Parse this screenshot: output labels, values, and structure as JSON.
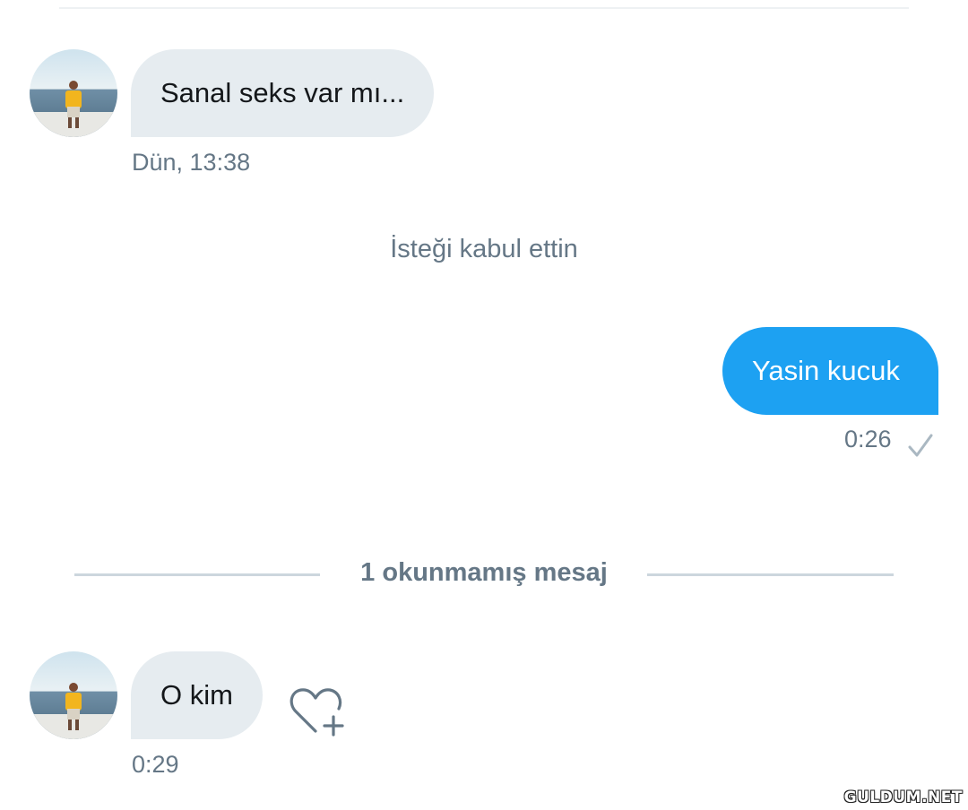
{
  "conversation": {
    "messages": [
      {
        "direction": "incoming",
        "text": "Sanal seks var mı...",
        "time": "Dün, 13:38"
      },
      {
        "direction": "outgoing",
        "text": "Yasin kucuk",
        "time": "0:26",
        "status_icon": "check-icon"
      },
      {
        "direction": "incoming",
        "text": "O kim",
        "time": "0:29",
        "reaction_icon": "heart-add-icon"
      }
    ],
    "system_note": "İsteği kabul ettin",
    "unread_divider": "1 okunmamış mesaj"
  },
  "watermark": "GULDUM.NET",
  "colors": {
    "incoming_bubble": "#e6ecf0",
    "outgoing_bubble": "#1da1f2",
    "secondary_text": "#657786",
    "divider": "#ccd6dd"
  }
}
